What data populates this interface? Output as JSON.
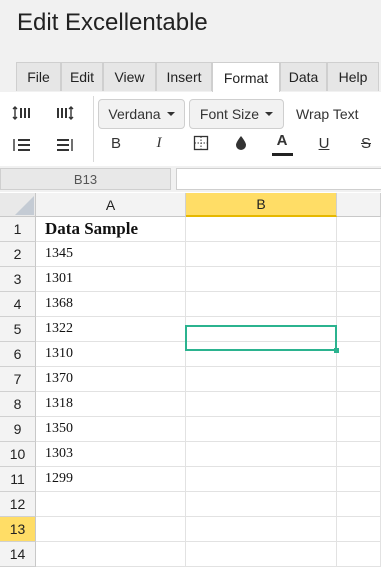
{
  "app": {
    "title": "Edit Excellentable"
  },
  "menu": {
    "tabs": [
      {
        "label": "File"
      },
      {
        "label": "Edit"
      },
      {
        "label": "View"
      },
      {
        "label": "Insert"
      },
      {
        "label": "Format",
        "active": true
      },
      {
        "label": "Data"
      },
      {
        "label": "Help"
      }
    ]
  },
  "toolbar": {
    "font_family": "Verdana",
    "font_size_label": "Font Size",
    "wrap_text_label": "Wrap Text",
    "bold_label": "B",
    "italic_label": "I",
    "underline_label": "U",
    "strike_label": "S",
    "font_color_label": "A"
  },
  "formula_bar": {
    "cell_ref": "B13",
    "value": ""
  },
  "sheet": {
    "columns": [
      "A",
      "B"
    ],
    "selected_column": "B",
    "selected_row": 13,
    "rows": [
      {
        "num": "1",
        "a": "Data Sample",
        "b": ""
      },
      {
        "num": "2",
        "a": "1345",
        "b": ""
      },
      {
        "num": "3",
        "a": "1301",
        "b": ""
      },
      {
        "num": "4",
        "a": "1368",
        "b": ""
      },
      {
        "num": "5",
        "a": "1322",
        "b": ""
      },
      {
        "num": "6",
        "a": "1310",
        "b": ""
      },
      {
        "num": "7",
        "a": "1370",
        "b": ""
      },
      {
        "num": "8",
        "a": "1318",
        "b": ""
      },
      {
        "num": "9",
        "a": "1350",
        "b": ""
      },
      {
        "num": "10",
        "a": "1303",
        "b": ""
      },
      {
        "num": "11",
        "a": "1299",
        "b": ""
      },
      {
        "num": "12",
        "a": "",
        "b": ""
      },
      {
        "num": "13",
        "a": "",
        "b": ""
      },
      {
        "num": "14",
        "a": "",
        "b": ""
      }
    ]
  },
  "colors": {
    "accent_selection": "#2bb38f",
    "header_highlight": "#ffdd66"
  }
}
